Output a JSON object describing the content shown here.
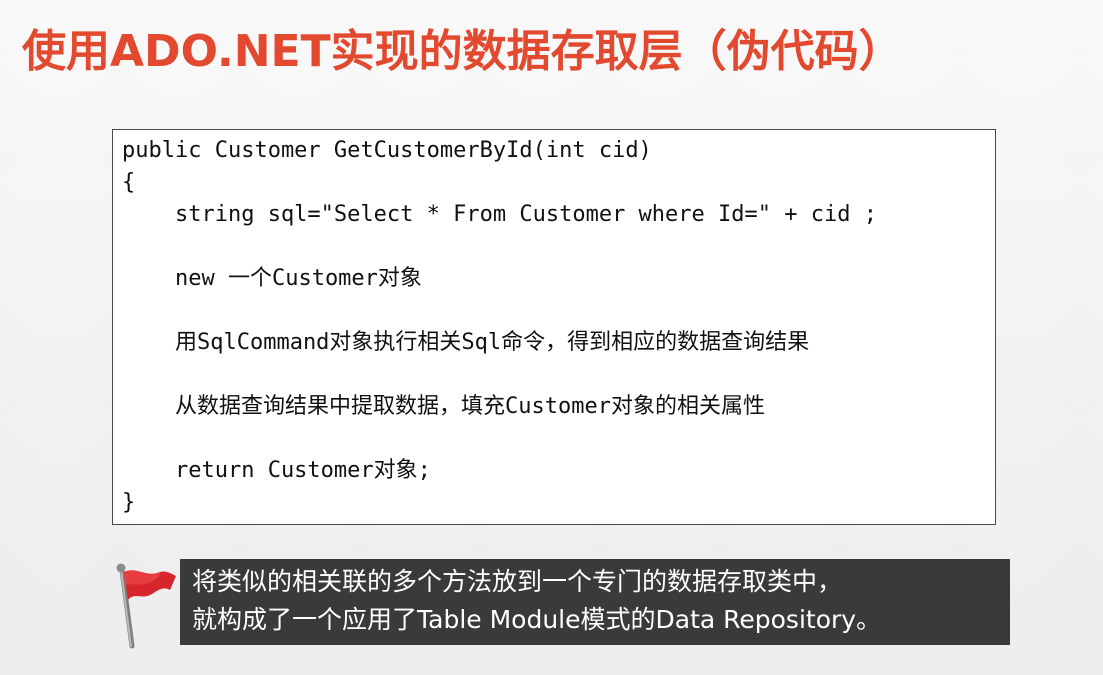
{
  "slide": {
    "title": "使用ADO.NET实现的数据存取层（伪代码）"
  },
  "code": {
    "lines": [
      "public Customer GetCustomerById(int cid)",
      "{",
      "    string sql=\"Select * From Customer where Id=\" + cid ;",
      "    new 一个Customer对象",
      "    用SqlCommand对象执行相关Sql命令，得到相应的数据查询结果",
      "    从数据查询结果中提取数据，填充Customer对象的相关属性",
      "    return Customer对象;",
      "}"
    ]
  },
  "note": {
    "line1": "将类似的相关联的多个方法放到一个专门的数据存取类中，",
    "line2": "就构成了一个应用了Table Module模式的Data Repository。"
  },
  "colors": {
    "title": "#e2492e",
    "note_background": "#3a3a3a",
    "flag": "#d7262b"
  },
  "icons": {
    "note_marker": "red-flag-icon"
  }
}
